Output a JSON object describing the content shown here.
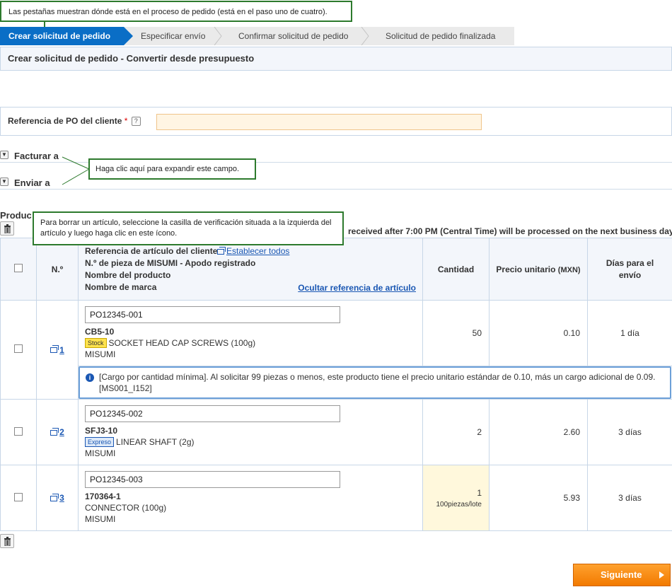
{
  "callouts": {
    "tabs": "Las pestañas muestran dónde está en el proceso de pedido (está en el paso uno de cuatro).",
    "expand": "Haga clic aquí para expandir este campo.",
    "delete": "Para borrar un artículo, seleccione la casilla de verificación situada a la izquierda del artículo y luego haga clic en este ícono."
  },
  "steps": [
    {
      "label": "Crear solicitud de pedido"
    },
    {
      "label": "Especificar envío"
    },
    {
      "label": "Confirmar solicitud de pedido"
    },
    {
      "label": "Solicitud de pedido finalizada"
    }
  ],
  "page_title": "Crear solicitud de pedido - Convertir desde presupuesto",
  "po": {
    "label": "Referencia de PO del cliente",
    "required_mark": "*",
    "help": "?",
    "value": ""
  },
  "sections": {
    "bill_to": "Facturar a",
    "ship_to": "Enviar a"
  },
  "products_heading": "Produc",
  "notice": "received after 7:00 PM (Central Time) will be processed on the next business day.",
  "table": {
    "headers": {
      "no": "N.º",
      "item_lines": [
        "Referencia de artículo del cliente",
        "N.º de pieza de MISUMI - Apodo registrado",
        "Nombre del producto",
        "Nombre de marca"
      ],
      "set_all": "Establecer todos",
      "hide_ref": "Ocultar referencia de artículo",
      "qty": "Cantidad",
      "unit_price": "Precio unitario",
      "currency": "(MXN)",
      "days": "Días para el envío"
    },
    "rows": [
      {
        "no": "1",
        "ref": "PO12345-001",
        "code": "CB5-10",
        "badge": "Stock",
        "badge_type": "stock",
        "name": "SOCKET HEAD CAP SCREWS (100g)",
        "brand": "MISUMI",
        "qty": "50",
        "lot": "",
        "price": "0.10",
        "days": "1 día",
        "info": "[Cargo por cantidad mínima]. Al solicitar 99 piezas o menos, este producto tiene el precio unitario estándar de 0.10, más un cargo adicional de 0.09. [MS001_I152]"
      },
      {
        "no": "2",
        "ref": "PO12345-002",
        "code": "SFJ3-10",
        "badge": "Expreso",
        "badge_type": "exp",
        "name": "LINEAR SHAFT (2g)",
        "brand": "MISUMI",
        "qty": "2",
        "lot": "",
        "price": "2.60",
        "days": "3 días",
        "info": ""
      },
      {
        "no": "3",
        "ref": "PO12345-003",
        "code": "170364-1",
        "badge": "",
        "badge_type": "",
        "name": "CONNECTOR (100g)",
        "brand": "MISUMI",
        "qty": "1",
        "lot": "100piezas/lote",
        "price": "5.93",
        "days": "3 días",
        "info": ""
      }
    ]
  },
  "next_button": "Siguiente",
  "colors": {
    "accent": "#0a6ec6",
    "callout_border": "#2d7a2d",
    "next": "#f27a00"
  }
}
